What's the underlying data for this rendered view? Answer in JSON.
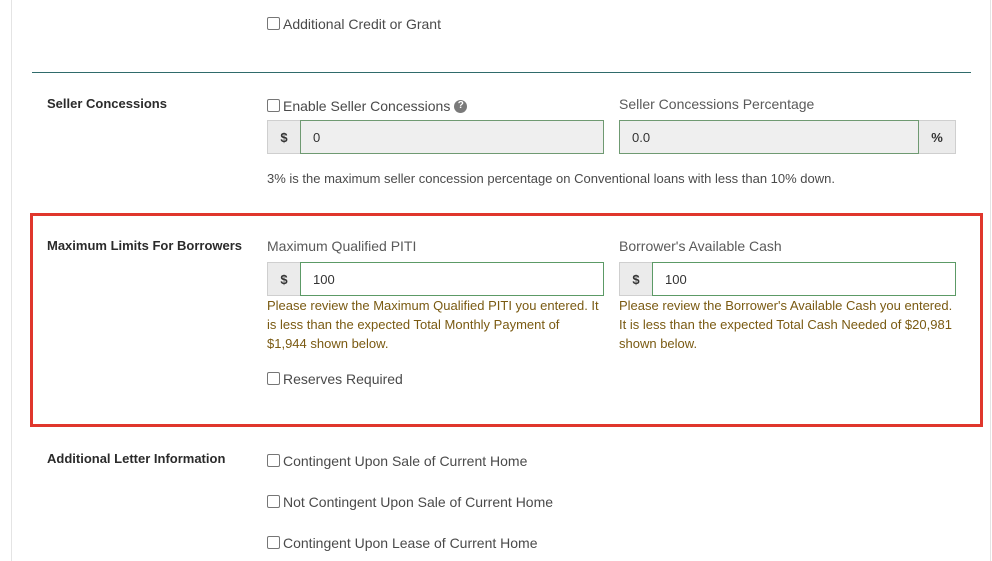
{
  "credit": {
    "additional_credit_label": "Additional Credit or Grant"
  },
  "seller": {
    "section_label": "Seller Concessions",
    "enable_label": "Enable Seller Concessions",
    "help_glyph": "?",
    "amount_prefix": "$",
    "amount_value": "0",
    "percentage_label": "Seller Concessions Percentage",
    "percentage_value": "0.0",
    "percentage_suffix": "%",
    "note": "3% is the maximum seller concession percentage on Conventional loans with less than 10% down."
  },
  "limits": {
    "section_label": "Maximum Limits For Borrowers",
    "piti_label": "Maximum Qualified PITI",
    "piti_prefix": "$",
    "piti_value": "100",
    "piti_warning_lines": [
      "Please review the Maximum Qualified PITI you entered. It",
      "is less than the expected Total Monthly Payment of",
      "$1,944 shown below."
    ],
    "cash_label": "Borrower's Available Cash",
    "cash_prefix": "$",
    "cash_value": "100",
    "cash_warning_lines": [
      "Please review the Borrower's Available Cash you entered.",
      "It is less than the expected Total Cash Needed of $20,981",
      "shown below."
    ],
    "reserves_label": "Reserves Required"
  },
  "letter": {
    "section_label": "Additional Letter Information",
    "options": [
      "Contingent Upon Sale of Current Home",
      "Not Contingent Upon Sale of Current Home",
      "Contingent Upon Lease of Current Home"
    ]
  },
  "colors": {
    "highlight": "#e0362c",
    "warning_text": "#7a5a12",
    "input_border": "#5c9a66",
    "divider": "#2f6b6b"
  }
}
